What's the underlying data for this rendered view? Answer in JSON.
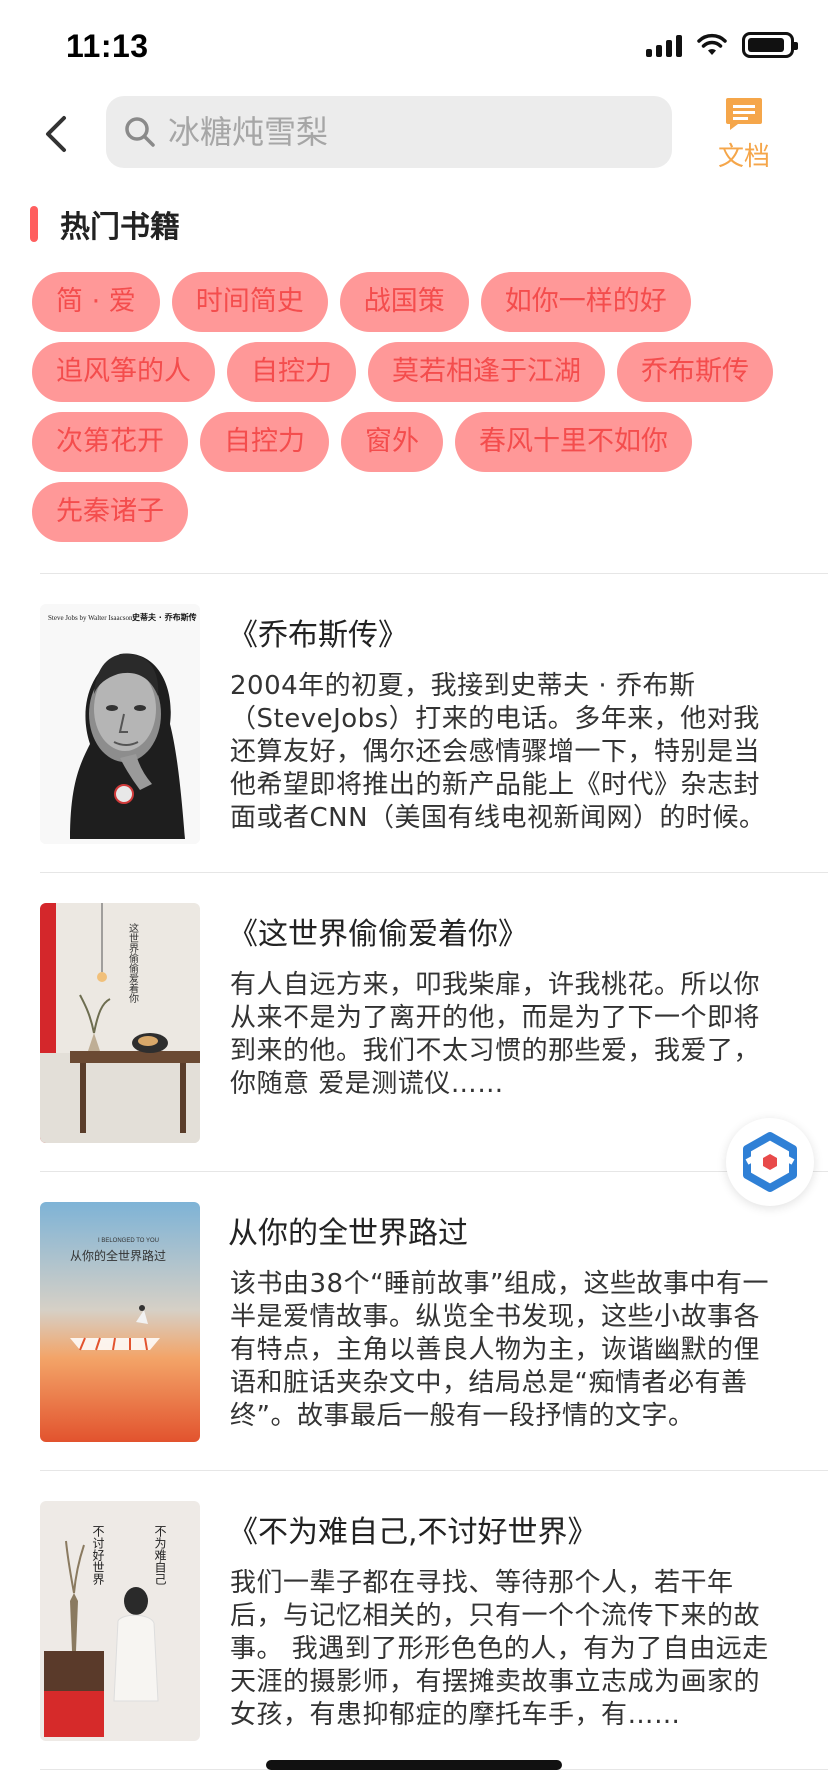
{
  "status_bar": {
    "time": "11:13"
  },
  "search": {
    "placeholder": "冰糖炖雪梨"
  },
  "doc_button": {
    "label": "文档"
  },
  "hot_books": {
    "title": "热门书籍",
    "tags": [
      "简 · 爱",
      "时间简史",
      "战国策",
      "如你一样的好",
      "追风筝的人",
      "自控力",
      "莫若相逢于江湖",
      "乔布斯传",
      "次第花开",
      "自控力",
      "窗外",
      "春风十里不如你",
      "先秦诸子"
    ]
  },
  "books": [
    {
      "title": "《乔布斯传》",
      "description": "2004年的初夏，我接到史蒂夫 · 乔布斯（SteveJobs）打来的电话。多年来，他对我还算友好，偶尔还会感情骤增一下，特别是当他希望即将推出的新产品能上《时代》杂志封面或者CNN（美国有线电视新闻网）的时候。",
      "cover_text_1": "Steve Jobs by Walter Isaacson",
      "cover_text_2": "史蒂夫 · 乔布斯传"
    },
    {
      "title": "《这世界偷偷爱着你》",
      "description": "有人自远方来，叩我柴扉，许我桃花。所以你从来不是为了离开的他，而是为了下一个即将到来的他。我们不太习惯的那些爱，我爱了，你随意 爱是测谎仪……",
      "cover_text_1": "这世界偷偷爱着你"
    },
    {
      "title": "从你的全世界路过",
      "description": "该书由38个“睡前故事”组成，这些故事中有一半是爱情故事。纵览全书发现，这些小故事各有特点，主角以善良人物为主，诙谐幽默的俚语和脏话夹杂文中，结局总是“痴情者必有善终”。故事最后一般有一段抒情的文字。",
      "cover_text_1": "I BELONGED TO YOU",
      "cover_text_2": "从你的全世界路过"
    },
    {
      "title": "《不为难自己,不讨好世界》",
      "description": "我们一辈子都在寻找、等待那个人，若干年后，与记忆相关的，只有一个个流传下来的故事。 我遇到了形形色色的人，有为了自由远走天涯的摄影师，有摆摊卖故事立志成为画家的女孩，有患抑郁症的摩托车手，有……",
      "cover_text_1": "不为难自己",
      "cover_text_2": "不讨好世界"
    }
  ],
  "colors": {
    "tag_bg": "#ff9898",
    "tag_text": "#f44d4d",
    "accent_orange": "#f5a64a",
    "section_bar": "#ff5f5f"
  },
  "icons": {
    "back": "chevron-left-icon",
    "search": "search-icon",
    "doc": "document-icon",
    "float": "hexagon-logo-icon"
  }
}
